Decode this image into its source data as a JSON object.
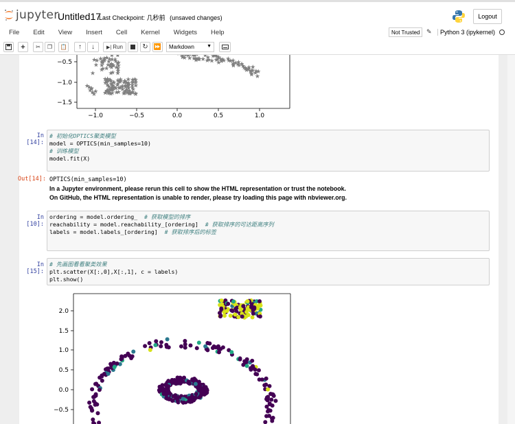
{
  "header": {
    "logo_text": "jupyter",
    "notebook_name": "Untitled17",
    "checkpoint_label": "Last Checkpoint:",
    "checkpoint_time": "几秒前",
    "save_status": "(unsaved changes)",
    "logout_label": "Logout"
  },
  "menu": [
    "File",
    "Edit",
    "View",
    "Insert",
    "Cell",
    "Kernel",
    "Widgets",
    "Help"
  ],
  "status": {
    "trusted": "Not Trusted",
    "kernel": "Python 3 (ipykernel)"
  },
  "toolbar": {
    "run_label": "Run",
    "cell_type": "Markdown",
    "icons": [
      "save-icon",
      "plus-icon",
      "cut-icon",
      "copy-icon",
      "paste-icon",
      "up-arrow-icon",
      "down-arrow-icon",
      "run-icon",
      "stop-icon",
      "restart-icon",
      "fast-forward-icon",
      "keyboard-icon"
    ]
  },
  "cells": {
    "c14": {
      "prompt": "In  [14]:",
      "lines": [
        "# 初始化OPTICS聚类模型",
        "model = OPTICS(min_samples=10)",
        "# 训练模型",
        "model.fit(X)"
      ],
      "out_prompt": "Out[14]:",
      "out_repr": "OPTICS(min_samples=10)",
      "warn1": "In a Jupyter environment, please rerun this cell to show the HTML representation or trust the notebook.",
      "warn2": "On GitHub, the HTML representation is unable to render, please try loading this page with nbviewer.org."
    },
    "c10": {
      "prompt": "In  [10]:",
      "l1_code": "ordering = model.ordering_  ",
      "l1_comment": "# 获取模型的排序",
      "l2_code": "reachability = model.reachability_[ordering]  ",
      "l2_comment": "# 获取排序的可达距离序列",
      "l3_code": "labels = model.labels_[ordering]  ",
      "l3_comment": "# 获取排序后的标签"
    },
    "c15": {
      "prompt": "In  [15]:",
      "lines": [
        "# 先画图看看聚类效果",
        "plt.scatter(X[:,0],X[:,1], c = labels)",
        "plt.show()"
      ]
    }
  },
  "plot_top": {
    "yticks": [
      "−0.5",
      "−1.0",
      "−1.5"
    ],
    "xticks": [
      "−1.0",
      "−0.5",
      "0.0",
      "0.5",
      "1.0"
    ],
    "marker_color": "#808080"
  },
  "plot_bottom": {
    "yticks": [
      "2.0",
      "1.5",
      "1.0",
      "0.5",
      "0.0",
      "−0.5"
    ],
    "colors": {
      "purple": "#440154",
      "teal": "#2a788e",
      "green": "#22a884",
      "yellow": "#d7e219"
    }
  }
}
